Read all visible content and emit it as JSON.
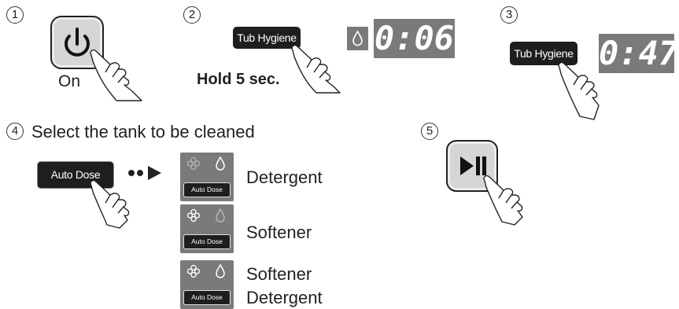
{
  "steps": [
    "1",
    "2",
    "3",
    "4",
    "5"
  ],
  "step1": {
    "caption": "On",
    "icon": "power-icon"
  },
  "step2": {
    "button_label": "Tub Hygiene",
    "caption": "Hold 5 sec.",
    "display": "0:06",
    "display_icon": "water-drop-icon"
  },
  "step3": {
    "button_label": "Tub Hygiene",
    "display": "0:47"
  },
  "step4": {
    "title": "Select the tank to be cleaned",
    "button_label": "Auto Dose",
    "options": [
      {
        "label_lines": [
          "Detergent"
        ],
        "panel_label": "Auto Dose",
        "softener_lit": false,
        "detergent_lit": true
      },
      {
        "label_lines": [
          "Softener"
        ],
        "panel_label": "Auto Dose",
        "softener_lit": true,
        "detergent_lit": false
      },
      {
        "label_lines": [
          "Softener",
          "Detergent"
        ],
        "panel_label": "Auto Dose",
        "softener_lit": true,
        "detergent_lit": true
      }
    ]
  },
  "step5": {
    "icon": "play-pause-icon"
  }
}
